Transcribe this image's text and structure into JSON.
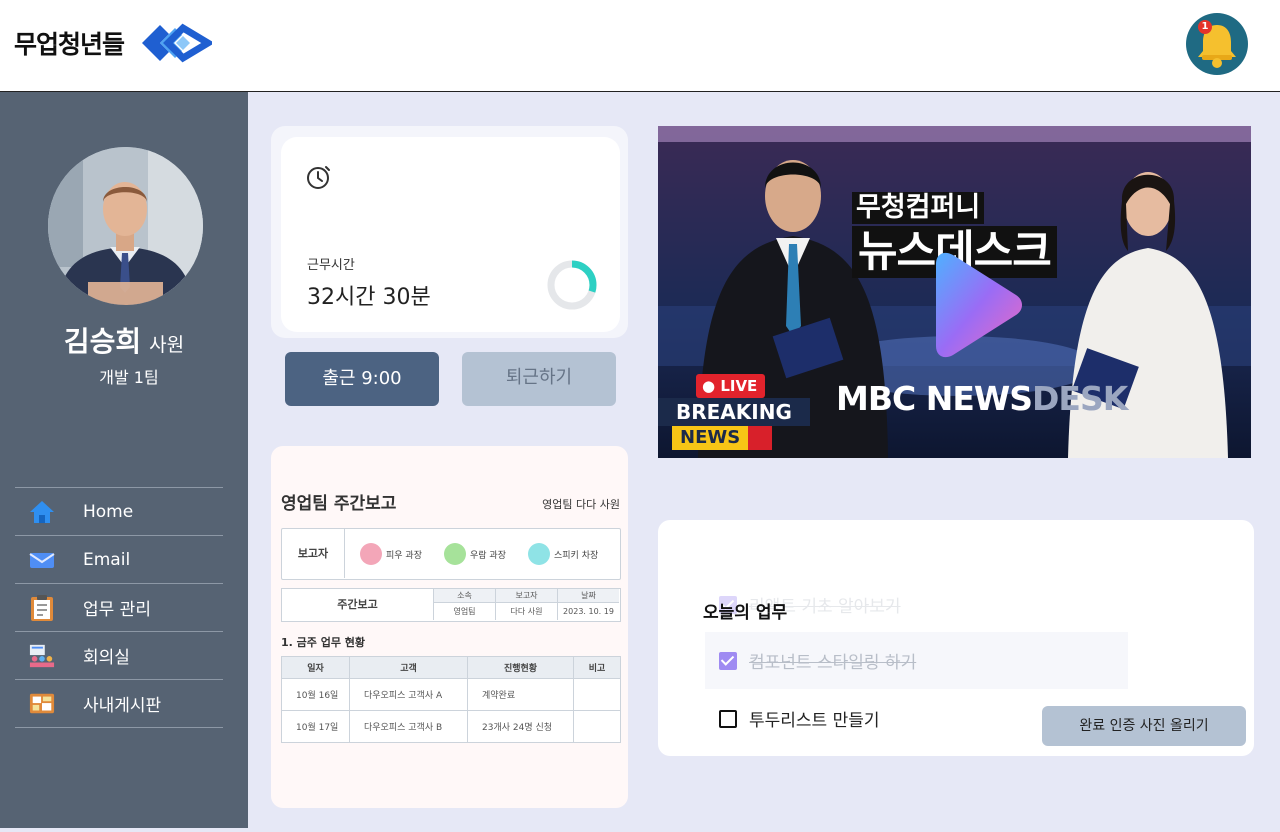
{
  "header": {
    "logo_text": "무업청년들",
    "notification_count": "1",
    "colors": {
      "logo_mark": "#1f5fd1",
      "bell": "#f5c02e",
      "bell_bg": "#1f6a83"
    }
  },
  "profile": {
    "name": "김승희",
    "rank": "사원",
    "team": "개발 1팀"
  },
  "nav": {
    "items": [
      {
        "label": "Home",
        "icon": "home-icon"
      },
      {
        "label": "Email",
        "icon": "email-icon"
      },
      {
        "label": "업무 관리",
        "icon": "clipboard-icon"
      },
      {
        "label": "회의실",
        "icon": "meeting-icon"
      },
      {
        "label": "사내게시판",
        "icon": "board-icon"
      }
    ]
  },
  "work_time": {
    "label": "근무시간",
    "value": "32시간 30분",
    "progress": 0.3
  },
  "attendance": {
    "clock_in_label": "출근 9:00",
    "clock_out_label": "퇴근하기"
  },
  "report": {
    "title": "영업팀 주간보고",
    "author": "영업팀 다다 사원",
    "reporter_label": "보고자",
    "reporters": [
      "피우 과장",
      "우람 과장",
      "스피키 차장"
    ],
    "type_label": "주간보고",
    "meta_headers": [
      "소속",
      "보고자",
      "날짜"
    ],
    "meta_values": [
      "영업팀",
      "다다 사원",
      "2023. 10. 19"
    ],
    "section_title": "1. 금주 업무 현황",
    "table": {
      "headers": [
        "일자",
        "고객",
        "진행현황",
        "비고"
      ],
      "rows": [
        [
          "10월 16일",
          "다우오피스 고객사 A",
          "계약완료",
          ""
        ],
        [
          "10월 17일",
          "다우오피스 고객사 B",
          "23개사 24명 신청",
          ""
        ]
      ]
    }
  },
  "video": {
    "title_small": "무청컴퍼니",
    "title_big": "뉴스데스크",
    "live": "LIVE",
    "breaking": "BREAKING",
    "news": "NEWS",
    "logo_main": "MBC NEWS",
    "logo_sub": "DESK"
  },
  "todo": {
    "title": "오늘의 업무",
    "items": [
      {
        "text": "리액트 기초 알아보기",
        "done": true
      },
      {
        "text": "컴포넌트 스타일링 하기",
        "done": true
      },
      {
        "text": "투두리스트 만들기",
        "done": false
      }
    ],
    "upload_label": "완료 인증 사진 올리기"
  }
}
